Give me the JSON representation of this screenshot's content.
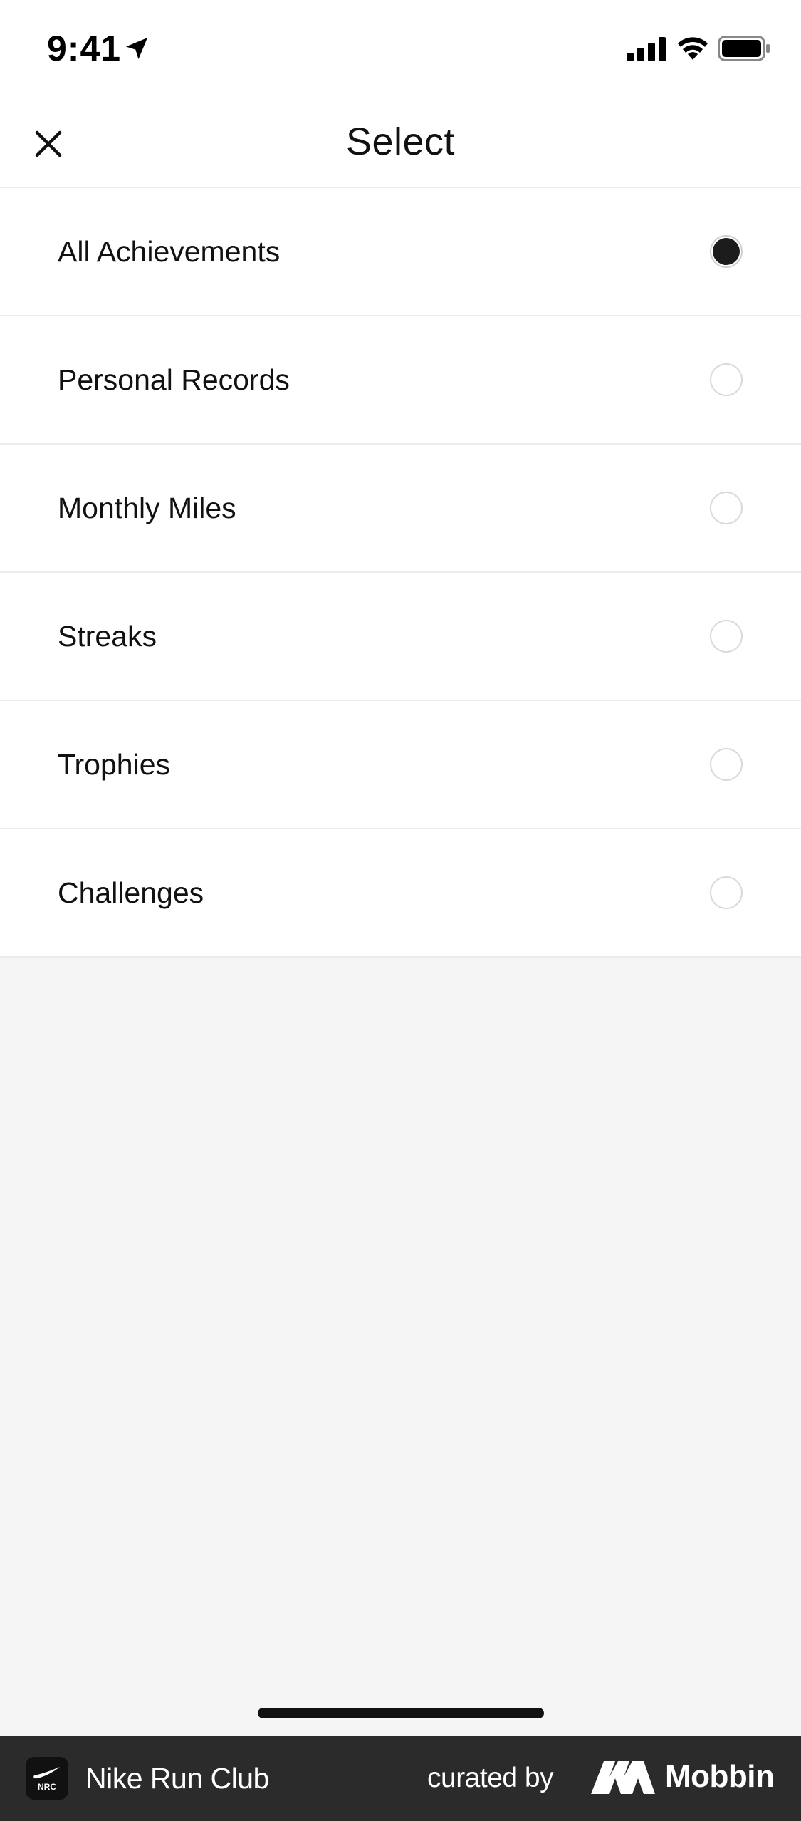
{
  "status_bar": {
    "time": "9:41",
    "icons": [
      "location-arrow-icon",
      "cellular-signal-icon",
      "wifi-icon",
      "battery-icon"
    ]
  },
  "header": {
    "title": "Select",
    "close_icon": "close-icon"
  },
  "options": [
    {
      "label": "All Achievements",
      "selected": true
    },
    {
      "label": "Personal Records",
      "selected": false
    },
    {
      "label": "Monthly Miles",
      "selected": false
    },
    {
      "label": "Streaks",
      "selected": false
    },
    {
      "label": "Trophies",
      "selected": false
    },
    {
      "label": "Challenges",
      "selected": false
    }
  ],
  "footer": {
    "app_name": "Nike Run Club",
    "app_logo_text": "NRC",
    "curated_by": "curated by",
    "brand": "Mobbin"
  },
  "colors": {
    "background": "#f5f5f5",
    "surface": "#ffffff",
    "text": "#111111",
    "divider": "#ececec",
    "radio_selected": "#1c1c1c",
    "footer": "#2b2b2b"
  }
}
